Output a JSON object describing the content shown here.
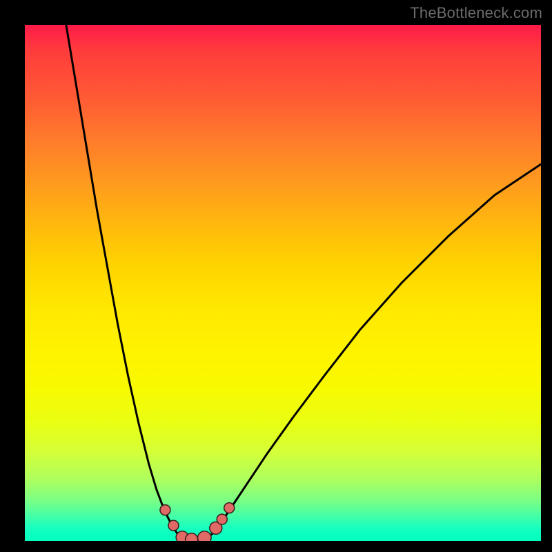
{
  "watermark": "TheBottleneck.com",
  "colors": {
    "frame": "#000000",
    "curve": "#000000",
    "marker_fill": "#e06a66",
    "marker_stroke": "#3a1b1b",
    "gradient_stops": [
      "#ff1a4a",
      "#ff3c3c",
      "#ff5a34",
      "#ff7a2c",
      "#ff981f",
      "#ffb60f",
      "#ffd200",
      "#ffe800",
      "#fff300",
      "#f8f900",
      "#eaff12",
      "#d3ff3a",
      "#aeff5e",
      "#7dff83",
      "#47ffa4",
      "#17ffc0",
      "#00ffbf"
    ]
  },
  "chart_data": {
    "type": "line",
    "title": "",
    "xlabel": "",
    "ylabel": "",
    "x_range": [
      0,
      100
    ],
    "y_range": [
      0,
      100
    ],
    "note": "No axis ticks or labels are rendered; values are read as percentages of the plotting area (0,0 = bottom-left).",
    "series": [
      {
        "name": "left-curve",
        "x": [
          8,
          10,
          12,
          14,
          16,
          18,
          20,
          22,
          24,
          25.5,
          27,
          28.5,
          29.5,
          30.5
        ],
        "y": [
          100,
          88,
          76,
          64,
          53,
          42,
          32,
          23,
          15,
          10,
          6,
          3,
          1.5,
          0.5
        ]
      },
      {
        "name": "valley-floor",
        "x": [
          30.5,
          32,
          33.5,
          35
        ],
        "y": [
          0.5,
          0.2,
          0.2,
          0.5
        ]
      },
      {
        "name": "right-curve",
        "x": [
          35,
          36.5,
          38,
          40,
          43,
          47,
          52,
          58,
          65,
          73,
          82,
          91,
          100
        ],
        "y": [
          0.5,
          1.5,
          3.5,
          6.5,
          11,
          17,
          24,
          32,
          41,
          50,
          59,
          67,
          73
        ]
      }
    ],
    "markers": [
      {
        "name": "m1",
        "x": 27.2,
        "y": 6.0,
        "r": 1.0
      },
      {
        "name": "m2",
        "x": 28.8,
        "y": 3.0,
        "r": 1.0
      },
      {
        "name": "m3",
        "x": 30.5,
        "y": 0.7,
        "r": 1.2
      },
      {
        "name": "m4",
        "x": 32.3,
        "y": 0.3,
        "r": 1.2
      },
      {
        "name": "m5",
        "x": 34.8,
        "y": 0.6,
        "r": 1.3
      },
      {
        "name": "m6",
        "x": 37.0,
        "y": 2.5,
        "r": 1.2
      },
      {
        "name": "m7",
        "x": 38.2,
        "y": 4.2,
        "r": 1.0
      },
      {
        "name": "m8",
        "x": 39.6,
        "y": 6.4,
        "r": 1.0
      }
    ]
  }
}
